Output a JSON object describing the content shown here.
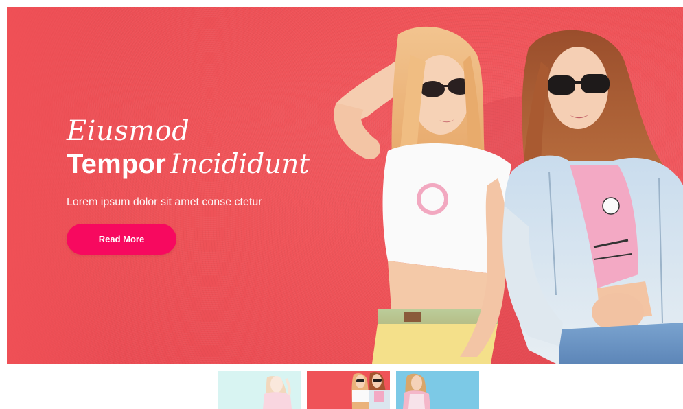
{
  "slider": {
    "active_index": 1,
    "slide": {
      "headline_italic_top": "Eiusmod",
      "headline_bold": "Tempor",
      "headline_italic_end": "Incididunt",
      "subtitle": "Lorem ipsum dolor sit amet conse ctetur",
      "button_label": "Read More"
    },
    "thumbnails": [
      {
        "theme": "mint",
        "active": false
      },
      {
        "theme": "coral",
        "active": true
      },
      {
        "theme": "sky",
        "active": false
      }
    ]
  },
  "colors": {
    "hero_background": "#ef5358",
    "button": "#f7095f",
    "thumb_mint": "#b9ece8",
    "thumb_coral": "#ef5358",
    "thumb_sky": "#7cc9e6"
  },
  "icons": {
    "hero_image": "two-models-photo",
    "thumb_images": [
      "model-photo-mint",
      "two-models-photo",
      "model-photo-sky"
    ]
  }
}
